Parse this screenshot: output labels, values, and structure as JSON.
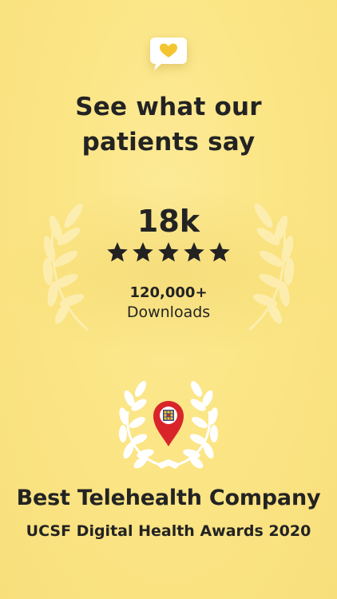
{
  "header": {
    "headline_line1": "See what our",
    "headline_line2": "patients say"
  },
  "ratings": {
    "count": "18k",
    "stars": 5
  },
  "downloads": {
    "count": "120,000+",
    "label": "Downloads"
  },
  "award": {
    "title": "Best Telehealth Company",
    "subtitle": "UCSF Digital Health Awards 2020"
  },
  "icons": {
    "top": "heart-chat-bubble-icon",
    "laurels": "laurel-wreath-icon",
    "award": "map-pin-icon"
  },
  "colors": {
    "background": "#fbe586",
    "text": "#232323",
    "accent_yellow": "#f5c531",
    "pin_red": "#d9252a"
  }
}
